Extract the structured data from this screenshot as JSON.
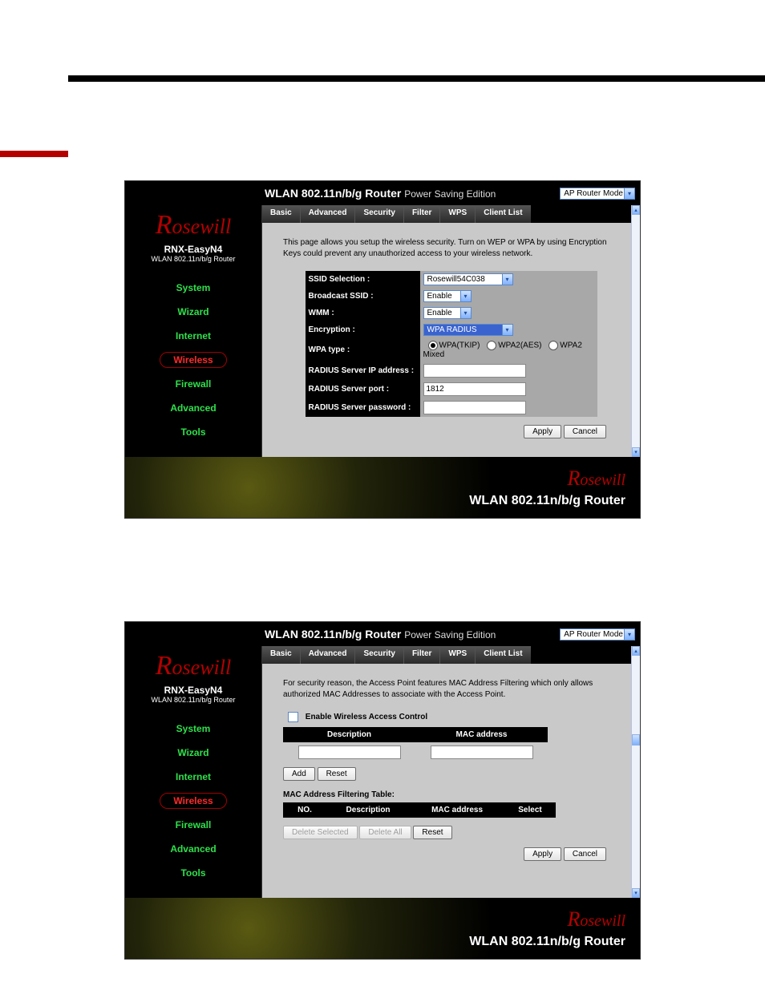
{
  "top_bar": {
    "title_bold": "WLAN 802.11n/b/g Router",
    "title_light": "Power Saving Edition",
    "mode_select": "AP Router Mode"
  },
  "sidebar": {
    "logo_text": "Rosewill",
    "device_name": "RNX-EasyN4",
    "device_sub": "WLAN 802.11n/b/g Router",
    "items": [
      "System",
      "Wizard",
      "Internet",
      "Wireless",
      "Firewall",
      "Advanced",
      "Tools"
    ],
    "selected_index": 3
  },
  "tabs": [
    "Basic",
    "Advanced",
    "Security",
    "Filter",
    "WPS",
    "Client List"
  ],
  "screen1": {
    "desc": "This page allows you setup the wireless security. Turn on WEP or WPA by using Encryption Keys could prevent any unauthorized access to your wireless network.",
    "rows": {
      "ssid_sel_label": "SSID Selection :",
      "ssid_sel_value": "Rosewill54C038",
      "broadcast_label": "Broadcast SSID :",
      "broadcast_value": "Enable",
      "wmm_label": "WMM :",
      "wmm_value": "Enable",
      "encryption_label": "Encryption :",
      "encryption_value": "WPA RADIUS",
      "wpa_type_label": "WPA type :",
      "wpa_options": [
        "WPA(TKIP)",
        "WPA2(AES)",
        "WPA2 Mixed"
      ],
      "wpa_selected": 0,
      "radius_ip_label": "RADIUS Server IP address :",
      "radius_ip_value": "",
      "radius_port_label": "RADIUS Server port :",
      "radius_port_value": "1812",
      "radius_pw_label": "RADIUS Server password :",
      "radius_pw_value": ""
    },
    "buttons": {
      "apply": "Apply",
      "cancel": "Cancel"
    }
  },
  "screen2": {
    "desc": "For security reason, the Access Point features MAC Address Filtering which only allows authorized MAC Addresses to associate with the Access Point.",
    "enable_label": "Enable Wireless Access Control",
    "col_desc": "Description",
    "col_mac": "MAC address",
    "add_btn": "Add",
    "reset_btn": "Reset",
    "table_title": "MAC Address Filtering Table:",
    "th_no": "NO.",
    "th_desc": "Description",
    "th_mac": "MAC address",
    "th_sel": "Select",
    "del_sel": "Delete Selected",
    "del_all": "Delete All",
    "reset2": "Reset",
    "apply": "Apply",
    "cancel": "Cancel"
  },
  "footer": {
    "logo": "Rosewill",
    "text": "WLAN 802.11n/b/g Router"
  }
}
